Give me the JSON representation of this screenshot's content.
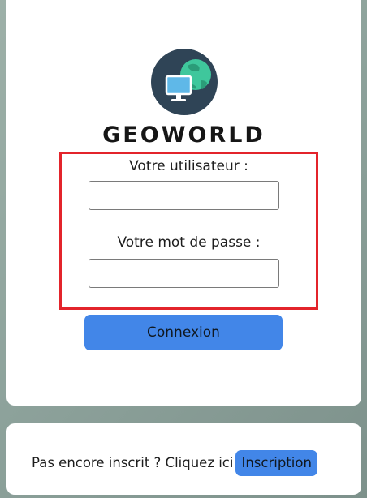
{
  "brand": {
    "name": "GEOWORLD",
    "logo_icon": "globe-computer-icon",
    "colors": {
      "logo_circle": "#2f4456",
      "globe": "#3fc79c",
      "monitor": "#5fb8e8"
    }
  },
  "login_form": {
    "username_label": "Votre utilisateur :",
    "username_value": "",
    "username_placeholder": "",
    "password_label": "Votre mot de passe :",
    "password_value": "",
    "password_placeholder": "",
    "submit_label": "Connexion",
    "highlight_color": "#e3242b"
  },
  "signup": {
    "prompt": "Pas encore inscrit ? Cliquez ici",
    "button_label": "Inscription"
  },
  "colors": {
    "accent": "#4286e8",
    "card_background": "#ffffff"
  }
}
